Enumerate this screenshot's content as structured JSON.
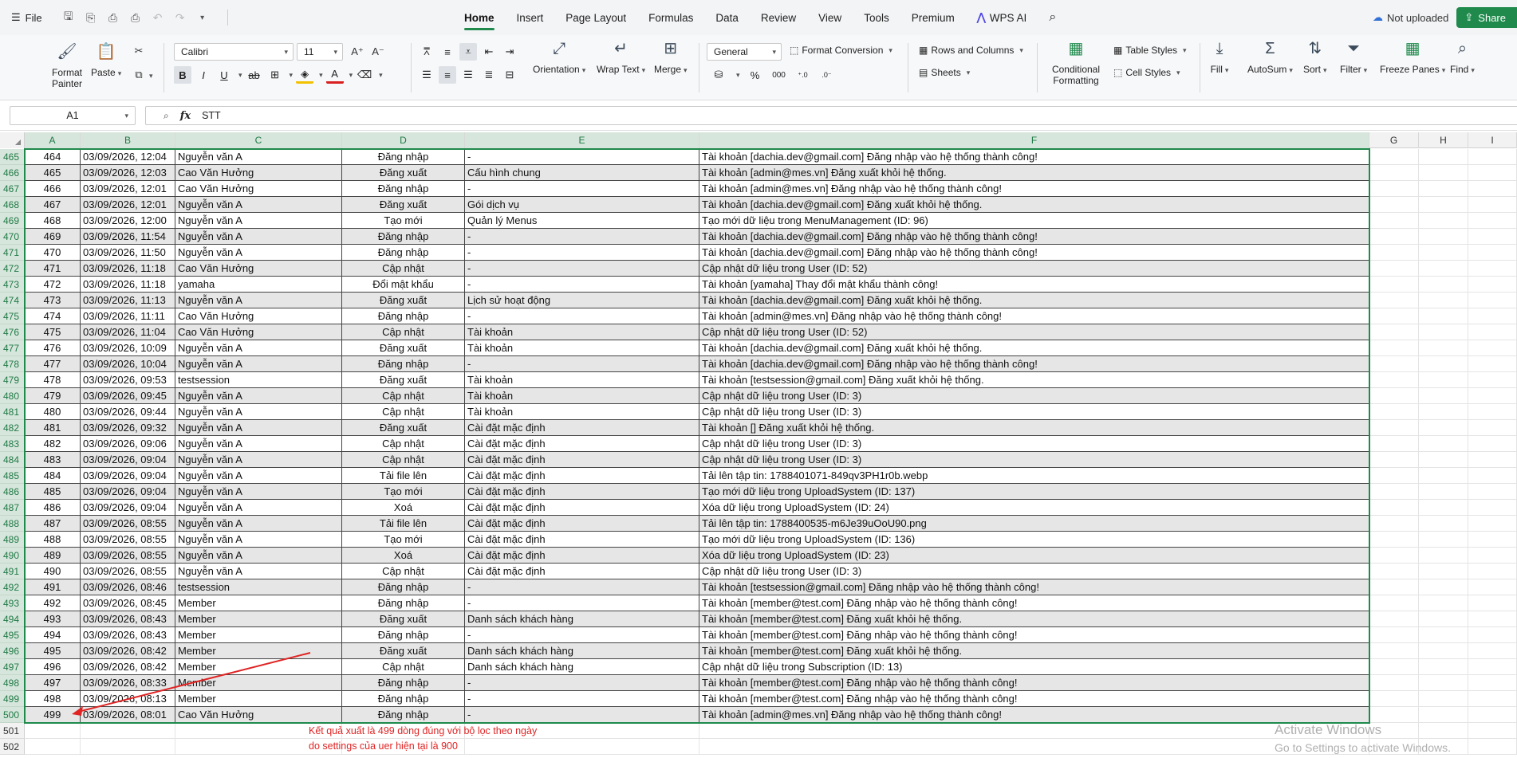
{
  "menubar": {
    "file_label": "File",
    "tabs": [
      "Home",
      "Insert",
      "Page Layout",
      "Formulas",
      "Data",
      "Review",
      "View",
      "Tools",
      "Premium"
    ],
    "active_tab": "Home",
    "wps_ai": "WPS AI",
    "not_uploaded": "Not uploaded",
    "share": "Share"
  },
  "ribbon": {
    "format_painter": "Format Painter",
    "paste": "Paste",
    "font_name": "Calibri",
    "font_size": "11",
    "orientation": "Orientation",
    "wrap_text": "Wrap Text",
    "merge": "Merge",
    "number_format": "General",
    "format_conversion": "Format Conversion",
    "rows_and_columns": "Rows and Columns",
    "sheets": "Sheets",
    "conditional_formatting": "Conditional Formatting",
    "table_styles": "Table Styles",
    "cell_styles": "Cell Styles",
    "fill": "Fill",
    "autosum": "AutoSum",
    "sort": "Sort",
    "filter": "Filter",
    "freeze_panes": "Freeze Panes",
    "find": "Find"
  },
  "formula_bar": {
    "name_box": "A1",
    "value": "STT"
  },
  "columns": [
    "A",
    "B",
    "C",
    "D",
    "E",
    "F",
    "G",
    "H",
    "I"
  ],
  "rows": [
    {
      "n": "465",
      "a": "464",
      "b": "03/09/2026, 12:04",
      "c": "Nguyễn văn A",
      "d": "Đăng nhập",
      "e": "-",
      "f": "Tài khoản [dachia.dev@gmail.com] Đăng nhập vào hệ thống thành công!"
    },
    {
      "n": "466",
      "a": "465",
      "b": "03/09/2026, 12:03",
      "c": "Cao Văn Hưởng",
      "d": "Đăng xuất",
      "e": "Cấu hình chung",
      "f": "Tài khoản [admin@mes.vn] Đăng xuất khỏi hệ thống."
    },
    {
      "n": "467",
      "a": "466",
      "b": "03/09/2026, 12:01",
      "c": "Cao Văn Hưởng",
      "d": "Đăng nhập",
      "e": "-",
      "f": "Tài khoản [admin@mes.vn] Đăng nhập vào hệ thống thành công!"
    },
    {
      "n": "468",
      "a": "467",
      "b": "03/09/2026, 12:01",
      "c": "Nguyễn văn A",
      "d": "Đăng xuất",
      "e": "Gói dịch vụ",
      "f": "Tài khoản [dachia.dev@gmail.com] Đăng xuất khỏi hệ thống."
    },
    {
      "n": "469",
      "a": "468",
      "b": "03/09/2026, 12:00",
      "c": "Nguyễn văn A",
      "d": "Tạo mới",
      "e": "Quản lý Menus",
      "f": "Tạo mới dữ liệu trong MenuManagement (ID: 96)"
    },
    {
      "n": "470",
      "a": "469",
      "b": "03/09/2026, 11:54",
      "c": "Nguyễn văn A",
      "d": "Đăng nhập",
      "e": "-",
      "f": "Tài khoản [dachia.dev@gmail.com] Đăng nhập vào hệ thống thành công!"
    },
    {
      "n": "471",
      "a": "470",
      "b": "03/09/2026, 11:50",
      "c": "Nguyễn văn A",
      "d": "Đăng nhập",
      "e": "-",
      "f": "Tài khoản [dachia.dev@gmail.com] Đăng nhập vào hệ thống thành công!"
    },
    {
      "n": "472",
      "a": "471",
      "b": "03/09/2026, 11:18",
      "c": "Cao Văn Hưởng",
      "d": "Cập nhật",
      "e": "-",
      "f": "Cập nhật dữ liệu trong User (ID: 52)"
    },
    {
      "n": "473",
      "a": "472",
      "b": "03/09/2026, 11:18",
      "c": "yamaha",
      "d": "Đổi mật khẩu",
      "e": "-",
      "f": "Tài khoản [yamaha] Thay đổi mật khẩu thành công!"
    },
    {
      "n": "474",
      "a": "473",
      "b": "03/09/2026, 11:13",
      "c": "Nguyễn văn A",
      "d": "Đăng xuất",
      "e": "Lịch sử hoạt động",
      "f": "Tài khoản [dachia.dev@gmail.com] Đăng xuất khỏi hệ thống."
    },
    {
      "n": "475",
      "a": "474",
      "b": "03/09/2026, 11:11",
      "c": "Cao Văn Hưởng",
      "d": "Đăng nhập",
      "e": "-",
      "f": "Tài khoản [admin@mes.vn] Đăng nhập vào hệ thống thành công!"
    },
    {
      "n": "476",
      "a": "475",
      "b": "03/09/2026, 11:04",
      "c": "Cao Văn Hưởng",
      "d": "Cập nhật",
      "e": "Tài khoản",
      "f": "Cập nhật dữ liệu trong User (ID: 52)"
    },
    {
      "n": "477",
      "a": "476",
      "b": "03/09/2026, 10:09",
      "c": "Nguyễn văn A",
      "d": "Đăng xuất",
      "e": "Tài khoản",
      "f": "Tài khoản [dachia.dev@gmail.com] Đăng xuất khỏi hệ thống."
    },
    {
      "n": "478",
      "a": "477",
      "b": "03/09/2026, 10:04",
      "c": "Nguyễn văn A",
      "d": "Đăng nhập",
      "e": "-",
      "f": "Tài khoản [dachia.dev@gmail.com] Đăng nhập vào hệ thống thành công!"
    },
    {
      "n": "479",
      "a": "478",
      "b": "03/09/2026, 09:53",
      "c": "testsession",
      "d": "Đăng xuất",
      "e": "Tài khoản",
      "f": "Tài khoản [testsession@gmail.com] Đăng xuất khỏi hệ thống."
    },
    {
      "n": "480",
      "a": "479",
      "b": "03/09/2026, 09:45",
      "c": "Nguyễn văn A",
      "d": "Cập nhật",
      "e": "Tài khoản",
      "f": "Cập nhật dữ liệu trong User (ID: 3)"
    },
    {
      "n": "481",
      "a": "480",
      "b": "03/09/2026, 09:44",
      "c": "Nguyễn văn A",
      "d": "Cập nhật",
      "e": "Tài khoản",
      "f": "Cập nhật dữ liệu trong User (ID: 3)"
    },
    {
      "n": "482",
      "a": "481",
      "b": "03/09/2026, 09:32",
      "c": "Nguyễn văn A",
      "d": "Đăng xuất",
      "e": "Cài đặt mặc định",
      "f": "Tài khoản [] Đăng xuất khỏi hệ thống."
    },
    {
      "n": "483",
      "a": "482",
      "b": "03/09/2026, 09:06",
      "c": "Nguyễn văn A",
      "d": "Cập nhật",
      "e": "Cài đặt mặc định",
      "f": "Cập nhật dữ liệu trong User (ID: 3)"
    },
    {
      "n": "484",
      "a": "483",
      "b": "03/09/2026, 09:04",
      "c": "Nguyễn văn A",
      "d": "Cập nhật",
      "e": "Cài đặt mặc định",
      "f": "Cập nhật dữ liệu trong User (ID: 3)"
    },
    {
      "n": "485",
      "a": "484",
      "b": "03/09/2026, 09:04",
      "c": "Nguyễn văn A",
      "d": "Tải file lên",
      "e": "Cài đặt mặc định",
      "f": "Tải lên tập tin: 1788401071-849qv3PH1r0b.webp"
    },
    {
      "n": "486",
      "a": "485",
      "b": "03/09/2026, 09:04",
      "c": "Nguyễn văn A",
      "d": "Tạo mới",
      "e": "Cài đặt mặc định",
      "f": "Tạo mới dữ liệu trong UploadSystem (ID: 137)"
    },
    {
      "n": "487",
      "a": "486",
      "b": "03/09/2026, 09:04",
      "c": "Nguyễn văn A",
      "d": "Xoá",
      "e": "Cài đặt mặc định",
      "f": "Xóa dữ liệu trong UploadSystem (ID: 24)"
    },
    {
      "n": "488",
      "a": "487",
      "b": "03/09/2026, 08:55",
      "c": "Nguyễn văn A",
      "d": "Tải file lên",
      "e": "Cài đặt mặc định",
      "f": "Tải lên tập tin: 1788400535-m6Je39uOoU90.png"
    },
    {
      "n": "489",
      "a": "488",
      "b": "03/09/2026, 08:55",
      "c": "Nguyễn văn A",
      "d": "Tạo mới",
      "e": "Cài đặt mặc định",
      "f": "Tạo mới dữ liệu trong UploadSystem (ID: 136)"
    },
    {
      "n": "490",
      "a": "489",
      "b": "03/09/2026, 08:55",
      "c": "Nguyễn văn A",
      "d": "Xoá",
      "e": "Cài đặt mặc định",
      "f": "Xóa dữ liệu trong UploadSystem (ID: 23)"
    },
    {
      "n": "491",
      "a": "490",
      "b": "03/09/2026, 08:55",
      "c": "Nguyễn văn A",
      "d": "Cập nhật",
      "e": "Cài đặt mặc định",
      "f": "Cập nhật dữ liệu trong User (ID: 3)"
    },
    {
      "n": "492",
      "a": "491",
      "b": "03/09/2026, 08:46",
      "c": "testsession",
      "d": "Đăng nhập",
      "e": "-",
      "f": "Tài khoản [testsession@gmail.com] Đăng nhập vào hệ thống thành công!"
    },
    {
      "n": "493",
      "a": "492",
      "b": "03/09/2026, 08:45",
      "c": "Member",
      "d": "Đăng nhập",
      "e": "-",
      "f": "Tài khoản [member@test.com] Đăng nhập vào hệ thống thành công!"
    },
    {
      "n": "494",
      "a": "493",
      "b": "03/09/2026, 08:43",
      "c": "Member",
      "d": "Đăng xuất",
      "e": "Danh sách khách hàng",
      "f": "Tài khoản [member@test.com] Đăng xuất khỏi hệ thống."
    },
    {
      "n": "495",
      "a": "494",
      "b": "03/09/2026, 08:43",
      "c": "Member",
      "d": "Đăng nhập",
      "e": "-",
      "f": "Tài khoản [member@test.com] Đăng nhập vào hệ thống thành công!"
    },
    {
      "n": "496",
      "a": "495",
      "b": "03/09/2026, 08:42",
      "c": "Member",
      "d": "Đăng xuất",
      "e": "Danh sách khách hàng",
      "f": "Tài khoản [member@test.com] Đăng xuất khỏi hệ thống."
    },
    {
      "n": "497",
      "a": "496",
      "b": "03/09/2026, 08:42",
      "c": "Member",
      "d": "Cập nhật",
      "e": "Danh sách khách hàng",
      "f": "Cập nhật dữ liệu trong Subscription (ID: 13)"
    },
    {
      "n": "498",
      "a": "497",
      "b": "03/09/2026, 08:33",
      "c": "Member",
      "d": "Đăng nhập",
      "e": "-",
      "f": "Tài khoản [member@test.com] Đăng nhập vào hệ thống thành công!"
    },
    {
      "n": "499",
      "a": "498",
      "b": "03/09/2026, 08:13",
      "c": "Member",
      "d": "Đăng nhập",
      "e": "-",
      "f": "Tài khoản [member@test.com] Đăng nhập vào hệ thống thành công!"
    },
    {
      "n": "500",
      "a": "499",
      "b": "03/09/2026, 08:01",
      "c": "Cao Văn Hưởng",
      "d": "Đăng nhập",
      "e": "-",
      "f": "Tài khoản [admin@mes.vn] Đăng nhập vào hệ thống thành công!"
    }
  ],
  "empty_rows": [
    "501",
    "502"
  ],
  "annotation": {
    "line1": "Kết quả xuất là 499 dòng đúng với bộ lọc theo ngày",
    "line2": "do settings của uer hiện tại là 900",
    "color": "#e02424"
  },
  "watermark": {
    "line1": "Activate Windows",
    "line2": "Go to Settings to activate Windows."
  }
}
